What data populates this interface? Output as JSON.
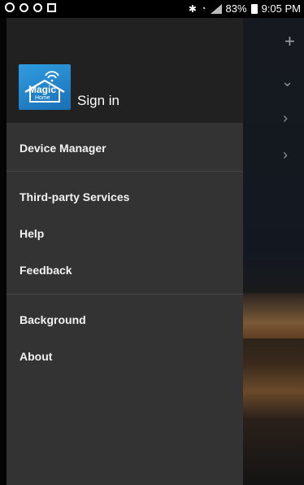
{
  "status_bar": {
    "battery": "83%",
    "time": "9:05 PM"
  },
  "drawer": {
    "header": {
      "logo_text": "Magic",
      "logo_subtext": "Home",
      "sign_in_label": "Sign in"
    },
    "items": [
      {
        "label": "Device Manager"
      },
      {
        "label": "Third-party Services"
      },
      {
        "label": "Help"
      },
      {
        "label": "Feedback"
      },
      {
        "label": "Background"
      },
      {
        "label": "About"
      }
    ]
  },
  "background": {
    "icons": [
      "plus-icon",
      "chevron-down-icon",
      "chevron-right-icon",
      "chevron-right-icon"
    ]
  }
}
